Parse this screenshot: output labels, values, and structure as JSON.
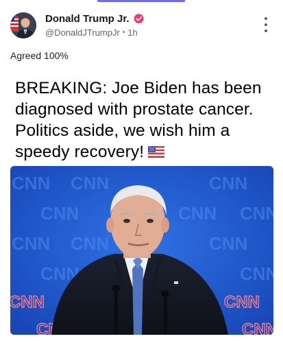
{
  "post": {
    "author_name": "Donald Trump Jr.",
    "handle": "@DonaldJTrumpJr",
    "separator": "•",
    "time": "1h",
    "comment": "Agreed 100%",
    "quoted_text": "BREAKING: Joe Biden has been diagnosed with prostate cancer. Politics aside, we wish him a speedy recovery!",
    "quoted_emoji": "us-flag",
    "image_watermark": "CNN",
    "image_brand_color": "#1c55c8"
  },
  "icons": {
    "verified": "verified-badge-icon",
    "menu": "more-vertical-icon"
  },
  "colors": {
    "accent_bar": "#6f6cf0",
    "verified_badge": "#e93b69",
    "text_secondary": "#5f6670"
  }
}
